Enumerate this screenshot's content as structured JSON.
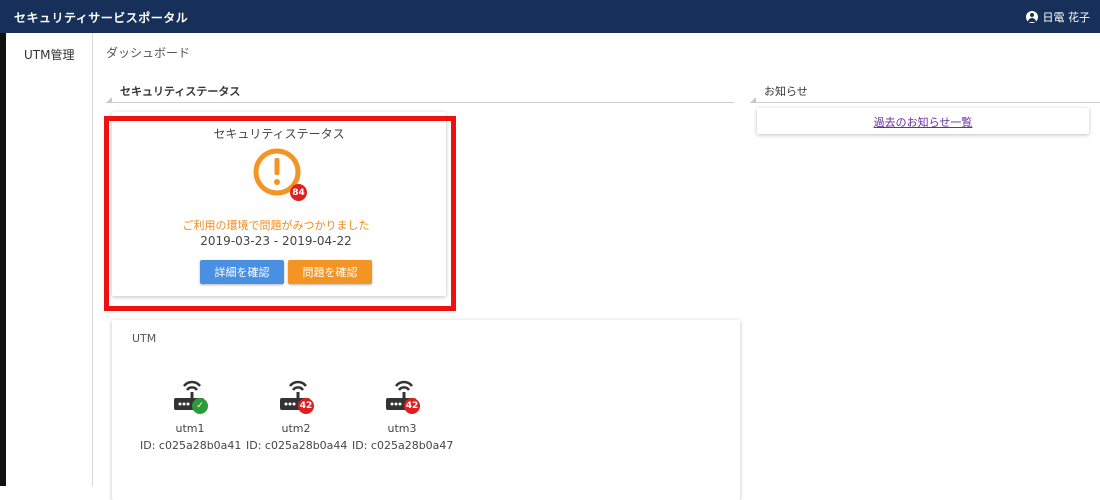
{
  "header": {
    "title": "セキュリティサービスポータル",
    "user_name": "日電 花子"
  },
  "sidebar": {
    "items": [
      {
        "label": "UTM管理"
      }
    ]
  },
  "breadcrumb": "ダッシュボード",
  "security_section": {
    "header": "セキュリティステータス",
    "card_title": "セキュリティステータス",
    "issue_count": "84",
    "message": "ご利用の環境で問題がみつかりました",
    "date_range": "2019-03-23 - 2019-04-22",
    "buttons": {
      "detail": "詳細を確認",
      "issue": "問題を確認"
    },
    "highlight_color": "#ee1111"
  },
  "utm_section": {
    "title": "UTM",
    "devices": [
      {
        "name": "utm1",
        "id": "ID: c025a28b0a41",
        "status": "ok",
        "badge": "✓"
      },
      {
        "name": "utm2",
        "id": "ID: c025a28b0a44",
        "status": "error",
        "badge": "42"
      },
      {
        "name": "utm3",
        "id": "ID: c025a28b0a47",
        "status": "error",
        "badge": "42"
      }
    ]
  },
  "news_section": {
    "header": "お知らせ",
    "link_label": "過去のお知らせ一覧"
  },
  "colors": {
    "header_bg": "#17305a",
    "warning_orange": "#f49422",
    "detail_blue": "#4a90e2",
    "error_red": "#e02020",
    "ok_green": "#2d9b3a",
    "link_purple": "#6a2ca0"
  }
}
